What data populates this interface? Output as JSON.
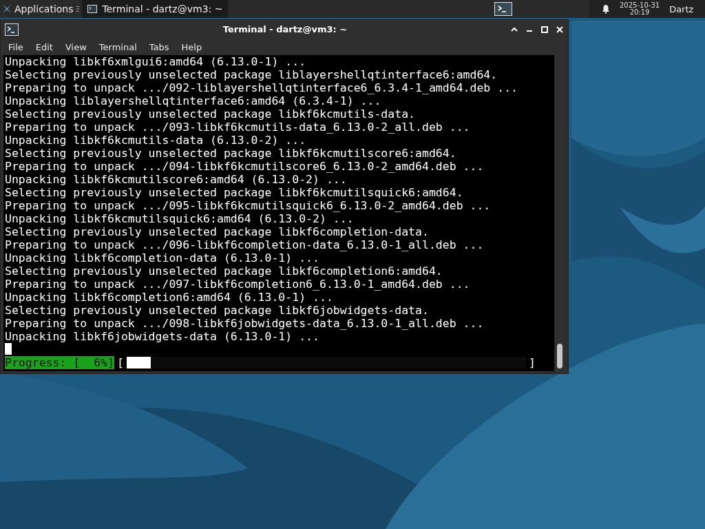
{
  "panel": {
    "apps_label": "Applications",
    "task": {
      "title": "Terminal - dartz@vm3: ~",
      "selected": true
    },
    "clock": {
      "date": "2025-10-31",
      "time": "20:19"
    },
    "user": "Dartz"
  },
  "window": {
    "title": "Terminal - dartz@vm3: ~"
  },
  "menu": [
    "File",
    "Edit",
    "View",
    "Terminal",
    "Tabs",
    "Help"
  ],
  "lines": [
    "Unpacking libkf6xmlgui6:amd64 (6.13.0-1) ...",
    "Selecting previously unselected package liblayershellqtinterface6:amd64.",
    "Preparing to unpack .../092-liblayershellqtinterface6_6.3.4-1_amd64.deb ...",
    "Unpacking liblayershellqtinterface6:amd64 (6.3.4-1) ...",
    "Selecting previously unselected package libkf6kcmutils-data.",
    "Preparing to unpack .../093-libkf6kcmutils-data_6.13.0-2_all.deb ...",
    "Unpacking libkf6kcmutils-data (6.13.0-2) ...",
    "Selecting previously unselected package libkf6kcmutilscore6:amd64.",
    "Preparing to unpack .../094-libkf6kcmutilscore6_6.13.0-2_amd64.deb ...",
    "Unpacking libkf6kcmutilscore6:amd64 (6.13.0-2) ...",
    "Selecting previously unselected package libkf6kcmutilsquick6:amd64.",
    "Preparing to unpack .../095-libkf6kcmutilsquick6_6.13.0-2_amd64.deb ...",
    "Unpacking libkf6kcmutilsquick6:amd64 (6.13.0-2) ...",
    "Selecting previously unselected package libkf6completion-data.",
    "Preparing to unpack .../096-libkf6completion-data_6.13.0-1_all.deb ...",
    "Unpacking libkf6completion-data (6.13.0-1) ...",
    "Selecting previously unselected package libkf6completion6:amd64.",
    "Preparing to unpack .../097-libkf6completion6_6.13.0-1_amd64.deb ...",
    "Unpacking libkf6completion6:amd64 (6.13.0-1) ...",
    "Selecting previously unselected package libkf6jobwidgets-data.",
    "Preparing to unpack .../098-libkf6jobwidgets-data_6.13.0-1_all.deb ...",
    "Unpacking libkf6jobwidgets-data (6.13.0-1) ..."
  ],
  "progress": {
    "label": "Progress: [  6%]",
    "open": "[",
    "close": "]",
    "level": 0.06
  }
}
